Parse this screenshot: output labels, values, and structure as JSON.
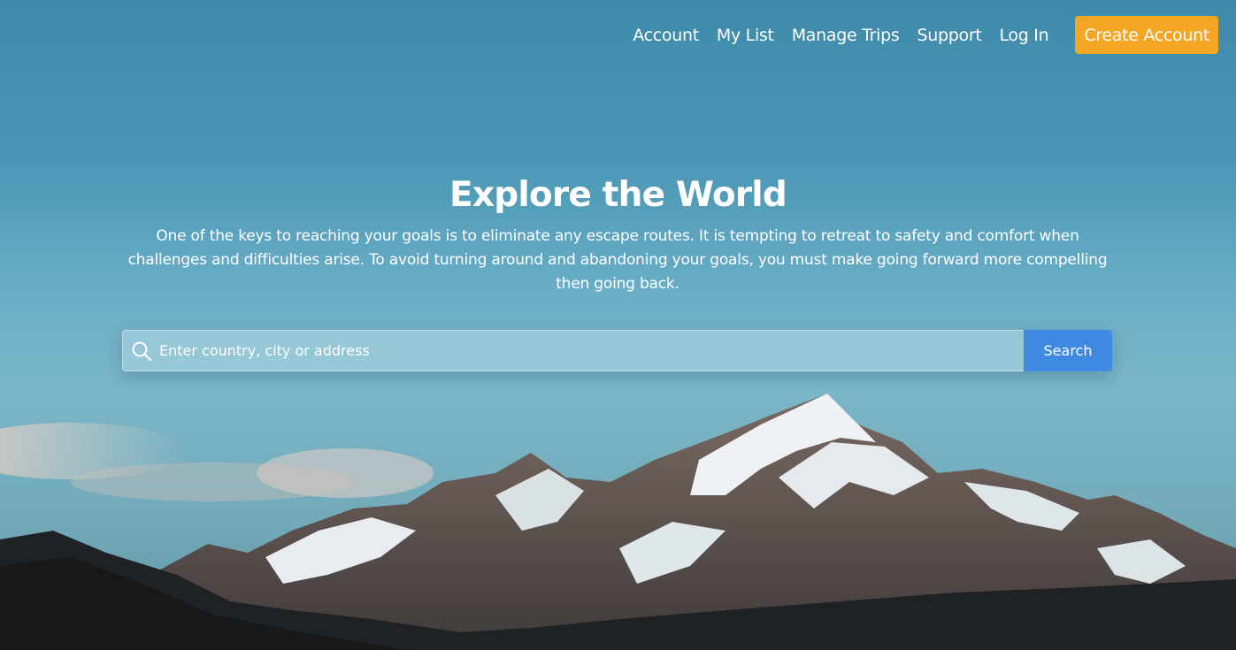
{
  "nav": {
    "links": [
      "Account",
      "My List",
      "Manage Trips",
      "Support",
      "Log In"
    ],
    "create_account": "Create Account"
  },
  "hero": {
    "title": "Explore the World",
    "subtitle": "One of the keys to reaching your goals is to eliminate any escape routes. It is tempting to retreat to safety and comfort when challenges and difficulties arise. To avoid turning around and abandoning your goals, you must make going forward more compelling then going back.",
    "background_image": "snow-capped mountain peak under blue sky"
  },
  "search": {
    "placeholder": "Enter country, city or address",
    "value": "",
    "button_label": "Search",
    "icon": "search-icon"
  },
  "colors": {
    "accent": "#f5a623",
    "search_button": "#3f8ae0"
  }
}
